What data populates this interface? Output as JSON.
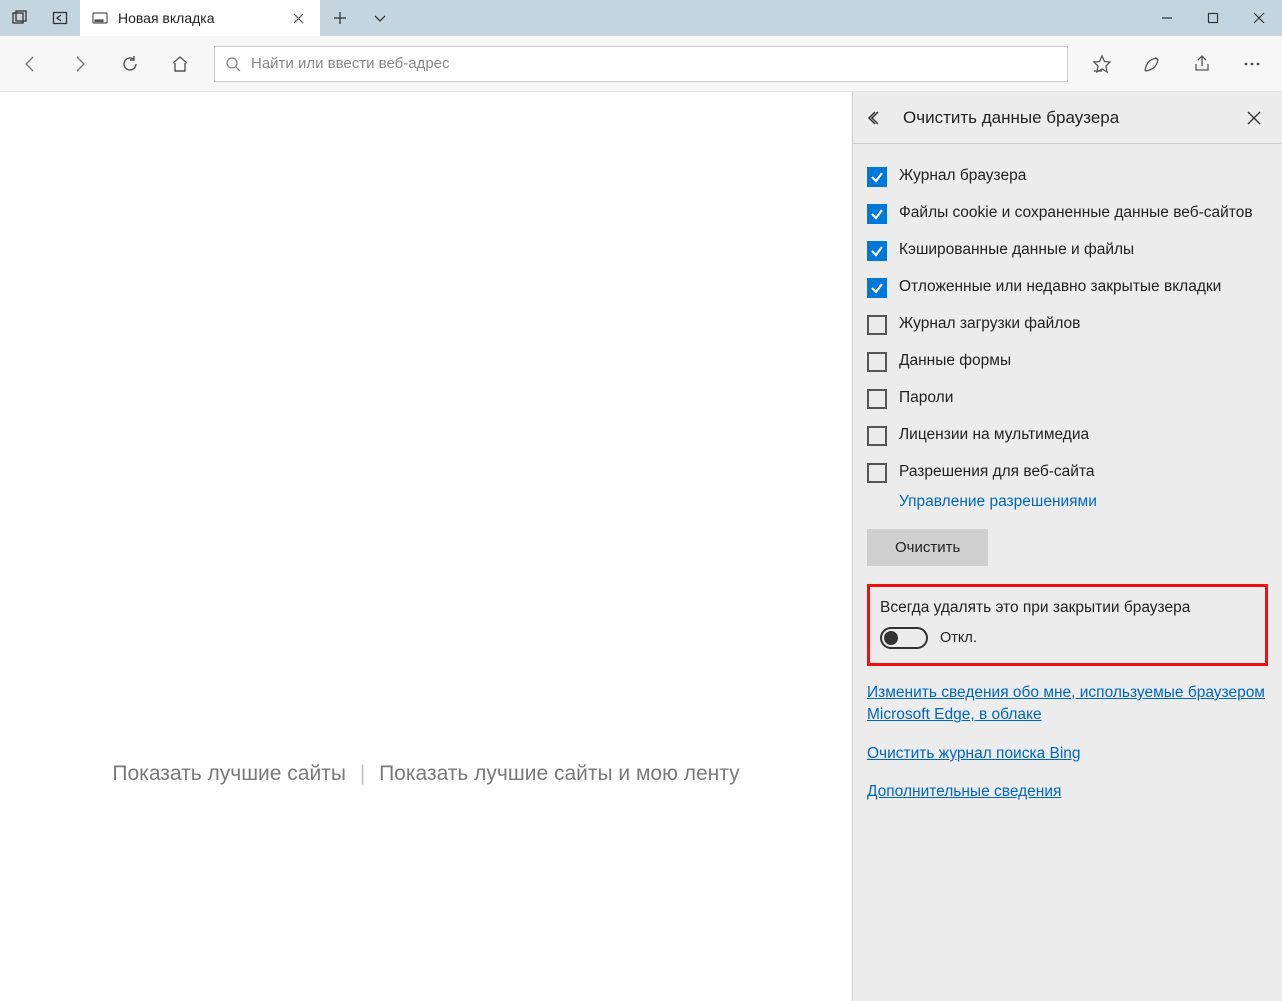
{
  "tab": {
    "title": "Новая вкладка"
  },
  "addressbar": {
    "placeholder": "Найти или ввести веб-адрес"
  },
  "content": {
    "show_top_sites": "Показать лучшие сайты",
    "show_top_sites_and_feed": "Показать лучшие сайты и мою ленту"
  },
  "panel": {
    "title": "Очистить данные браузера",
    "items": [
      {
        "label": "Журнал браузера",
        "checked": true
      },
      {
        "label": "Файлы cookie и сохраненные данные веб-сайтов",
        "checked": true
      },
      {
        "label": "Кэшированные данные и файлы",
        "checked": true
      },
      {
        "label": "Отложенные или недавно закрытые вкладки",
        "checked": true
      },
      {
        "label": "Журнал загрузки файлов",
        "checked": false
      },
      {
        "label": "Данные формы",
        "checked": false
      },
      {
        "label": "Пароли",
        "checked": false
      },
      {
        "label": "Лицензии на мультимедиа",
        "checked": false
      },
      {
        "label": "Разрешения для веб-сайта",
        "checked": false
      }
    ],
    "manage_permissions": "Управление разрешениями",
    "clear_button": "Очистить",
    "always_clear": {
      "title": "Всегда удалять это при закрытии браузера",
      "state_label": "Откл.",
      "on": false
    },
    "links": {
      "change_info": "Изменить сведения обо мне, используемые браузером Microsoft Edge, в облаке",
      "clear_bing": "Очистить журнал поиска Bing",
      "more_info": "Дополнительные сведения"
    }
  }
}
